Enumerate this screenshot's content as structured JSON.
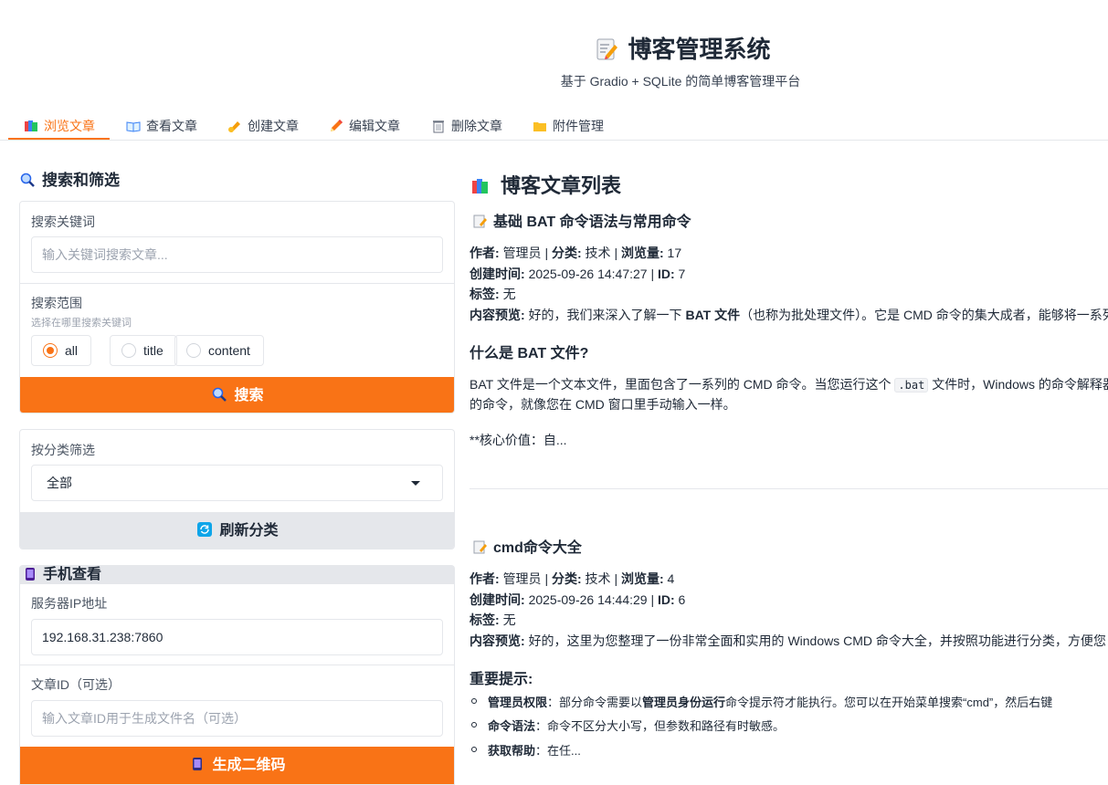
{
  "app": {
    "title": "博客管理系统",
    "subtitle": "基于 Gradio + SQLite 的简单博客管理平台"
  },
  "tabs": [
    {
      "label": "浏览文章",
      "active": true
    },
    {
      "label": "查看文章"
    },
    {
      "label": "创建文章"
    },
    {
      "label": "编辑文章"
    },
    {
      "label": "删除文章"
    },
    {
      "label": "附件管理"
    }
  ],
  "left": {
    "heading": "搜索和筛选",
    "keyword": {
      "label": "搜索关键词",
      "placeholder": "输入关键词搜索文章..."
    },
    "scope": {
      "label": "搜索范围",
      "info": "选择在哪里搜索关键词",
      "options": [
        "all",
        "title",
        "content"
      ],
      "selected": "all"
    },
    "search_button": "搜索",
    "category": {
      "label": "按分类筛选",
      "value": "全部"
    },
    "refresh_button": "刷新分类",
    "mobile": {
      "heading": "手机查看",
      "server_label": "服务器IP地址",
      "server_value": "192.168.31.238:7860",
      "article_label": "文章ID（可选）",
      "article_placeholder": "输入文章ID用于生成文件名（可选）",
      "qr_button": "生成二维码"
    }
  },
  "right": {
    "heading": "博客文章列表",
    "labels": {
      "author": "作者:",
      "category": "分类:",
      "views": "浏览量:",
      "created": "创建时间:",
      "id": "ID:",
      "tags": "标签:",
      "preview": "内容预览:",
      "sep": "|"
    },
    "posts": [
      {
        "title": "基础 BAT 命令语法与常用命令",
        "author": "管理员",
        "category": "技术",
        "views": "17",
        "created": "2025-09-26 14:47:27",
        "id": "7",
        "tags": "无",
        "preview_a": "好的，我们来深入了解一下",
        "preview_b": "BAT 文件",
        "preview_c": "（也称为批处理文件）。它是 CMD 命令的集大成者，能够将一系列",
        "h3": "什么是 BAT 文件?",
        "para_a": "BAT 文件是一个文本文件，里面包含了一系列的 CMD 命令。当您运行这个",
        "para_code": ".bat",
        "para_b": "文件时，Windows 的命令解释器",
        "para_c": "的命令，就像您在 CMD 窗口里手动输入一样。",
        "tail": "**核心价值：自..."
      },
      {
        "title": "cmd命令大全",
        "author": "管理员",
        "category": "技术",
        "views": "4",
        "created": "2025-09-26 14:44:29",
        "id": "6",
        "tags": "无",
        "preview_a": "好的，这里为您整理了一份非常全面和实用的 Windows CMD 命令大全，并按照功能进行分类，方便您",
        "h3": "重要提示:",
        "items": [
          {
            "b": "管理员权限",
            "t1": "：部分命令需要以",
            "b2": "管理员身份运行",
            "t2": "命令提示符才能执行。您可以在开始菜单搜索“cmd”，然后右键"
          },
          {
            "b": "命令语法",
            "t1": "：命令不区分大小写，但参数和路径有时敏感。"
          },
          {
            "b": "获取帮助",
            "t1": "：在任..."
          }
        ]
      }
    ]
  }
}
